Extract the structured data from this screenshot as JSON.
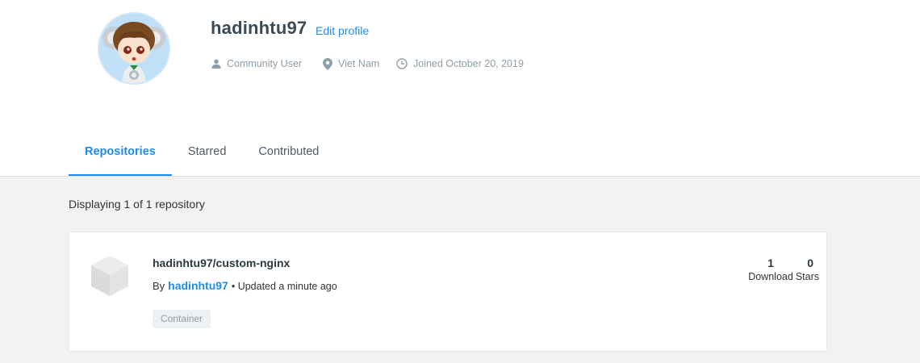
{
  "profile": {
    "username": "hadinhtu97",
    "edit_label": "Edit profile",
    "role": "Community User",
    "location": "Viet Nam",
    "joined": "Joined October 20, 2019"
  },
  "tabs": [
    {
      "label": "Repositories",
      "active": true
    },
    {
      "label": "Starred",
      "active": false
    },
    {
      "label": "Contributed",
      "active": false
    }
  ],
  "results": {
    "count_text": "Displaying 1 of 1 repository"
  },
  "repositories": [
    {
      "name": "hadinhtu97/custom-nginx",
      "by_label": "By",
      "owner": "hadinhtu97",
      "updated": "• Updated a minute ago",
      "tag": "Container",
      "downloads": "1",
      "downloads_label": "Download",
      "stars": "0",
      "stars_label": "Stars"
    }
  ],
  "colors": {
    "accent": "#1f8ceb",
    "page_bg": "#f2f2f2",
    "muted": "#8f9ea8"
  },
  "icons": [
    "user-icon",
    "location-pin-icon",
    "clock-icon",
    "repository-cube-icon"
  ]
}
